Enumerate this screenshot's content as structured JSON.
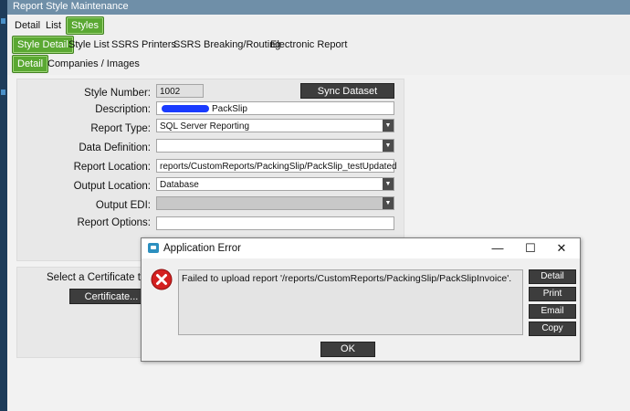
{
  "window": {
    "title": "Report Style Maintenance"
  },
  "top_tabs": [
    "Detail",
    "List",
    "Styles"
  ],
  "sub_tabs": [
    "Style Detail",
    "Style List",
    "SSRS Printers",
    "SSRS Breaking/Routing",
    "Electronic Report"
  ],
  "detail_tabs": [
    "Detail",
    "Companies / Images"
  ],
  "form": {
    "style_number_label": "Style Number:",
    "style_number_value": "1002",
    "sync_button": "Sync Dataset",
    "description_label": "Description:",
    "description_value": "PackSlip",
    "report_type_label": "Report Type:",
    "report_type_value": "SQL Server Reporting",
    "data_definition_label": "Data Definition:",
    "data_definition_value": "",
    "report_location_label": "Report Location:",
    "report_location_value": "reports/CustomReports/PackingSlip/PackSlip_testUpdated",
    "output_location_label": "Output Location:",
    "output_location_value": "Database",
    "output_edi_label": "Output EDI:",
    "output_edi_value": "",
    "report_options_label": "Report Options:",
    "report_options_value": ""
  },
  "certificate": {
    "label": "Select a Certificate to sig",
    "button": "Certificate..."
  },
  "dialog": {
    "title": "Application Error",
    "message": "Failed to upload report '/reports/CustomReports/PackingSlip/PackSlipInvoice'.",
    "buttons": [
      "Detail",
      "Print",
      "Email",
      "Copy"
    ],
    "ok": "OK",
    "controls": {
      "minimize": "—",
      "maximize": "☐",
      "close": "✕"
    }
  },
  "colors": {
    "tab_active": "#5aa832",
    "titlebar": "#6f8fa8",
    "error_icon": "#d42020"
  }
}
